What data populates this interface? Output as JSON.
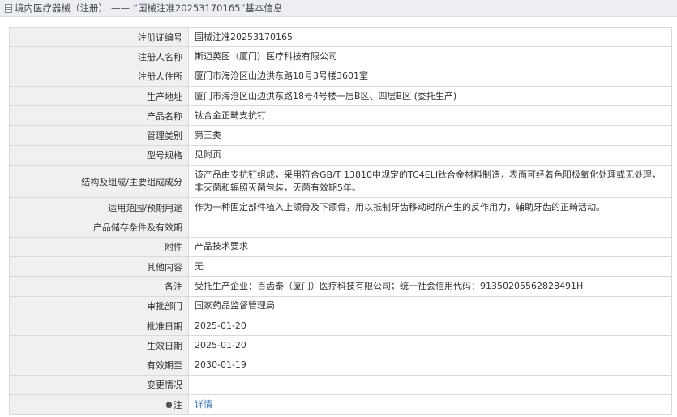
{
  "breadcrumb": {
    "category": "境内医疗器械（注册）",
    "separator": "——",
    "record": "“国械注准20253170165”",
    "suffix": "基本信息"
  },
  "rows": [
    {
      "key": "registration-number",
      "label": "注册证编号",
      "value": "国械注准20253170165"
    },
    {
      "key": "registrant-name",
      "label": "注册人名称",
      "value": "斯迈英图（厦门）医疗科技有限公司"
    },
    {
      "key": "registrant-address",
      "label": "注册人住所",
      "value": "厦门市海沧区山边洪东路18号3号楼3601室"
    },
    {
      "key": "production-address",
      "label": "生产地址",
      "value": "厦门市海沧区山边洪东路18号4号楼一层B区、四层B区 (委托生产)"
    },
    {
      "key": "product-name",
      "label": "产品名称",
      "value": "钛合金正畸支抗钉"
    },
    {
      "key": "management-class",
      "label": "管理类别",
      "value": "第三类"
    },
    {
      "key": "model-spec",
      "label": "型号规格",
      "value": "见附页"
    },
    {
      "key": "structure",
      "label": "结构及组成/主要组成成分",
      "value": "该产品由支抗钉组成，采用符合GB/T 13810中规定的TC4ELI钛合金材料制造，表面可经着色阳极氧化处理或无处理，非灭菌和辐照灭菌包装，灭菌有效期5年。"
    },
    {
      "key": "intended-use",
      "label": "适用范围/预期用途",
      "value": "作为一种固定部件植入上颌骨及下颌骨，用以抵制牙齿移动时所产生的反作用力，辅助牙齿的正畸活动。"
    },
    {
      "key": "storage",
      "label": "产品储存条件及有效期",
      "value": ""
    },
    {
      "key": "attachment",
      "label": "附件",
      "value": "产品技术要求"
    },
    {
      "key": "other-content",
      "label": "其他内容",
      "value": "无"
    },
    {
      "key": "remarks",
      "label": "备注",
      "value": "受托生产企业：百齿泰（厦门）医疗科技有限公司；统一社会信用代码：91350205562828491H"
    },
    {
      "key": "approval-dept",
      "label": "审批部门",
      "value": "国家药品监督管理局"
    },
    {
      "key": "approval-date",
      "label": "批准日期",
      "value": "2025-01-20"
    },
    {
      "key": "effective-date",
      "label": "生效日期",
      "value": "2025-01-20"
    },
    {
      "key": "expiry-date",
      "label": "有效期至",
      "value": "2030-01-19"
    },
    {
      "key": "change-status",
      "label": "变更情况",
      "value": ""
    }
  ],
  "note": {
    "label": "注",
    "icon": "lightbulb-icon",
    "link_text": "详情"
  },
  "colors": {
    "header_bg": "#eceef2",
    "label_bg": "#f0f0f0",
    "border": "#d9d9d9",
    "link": "#2f6fb8"
  }
}
